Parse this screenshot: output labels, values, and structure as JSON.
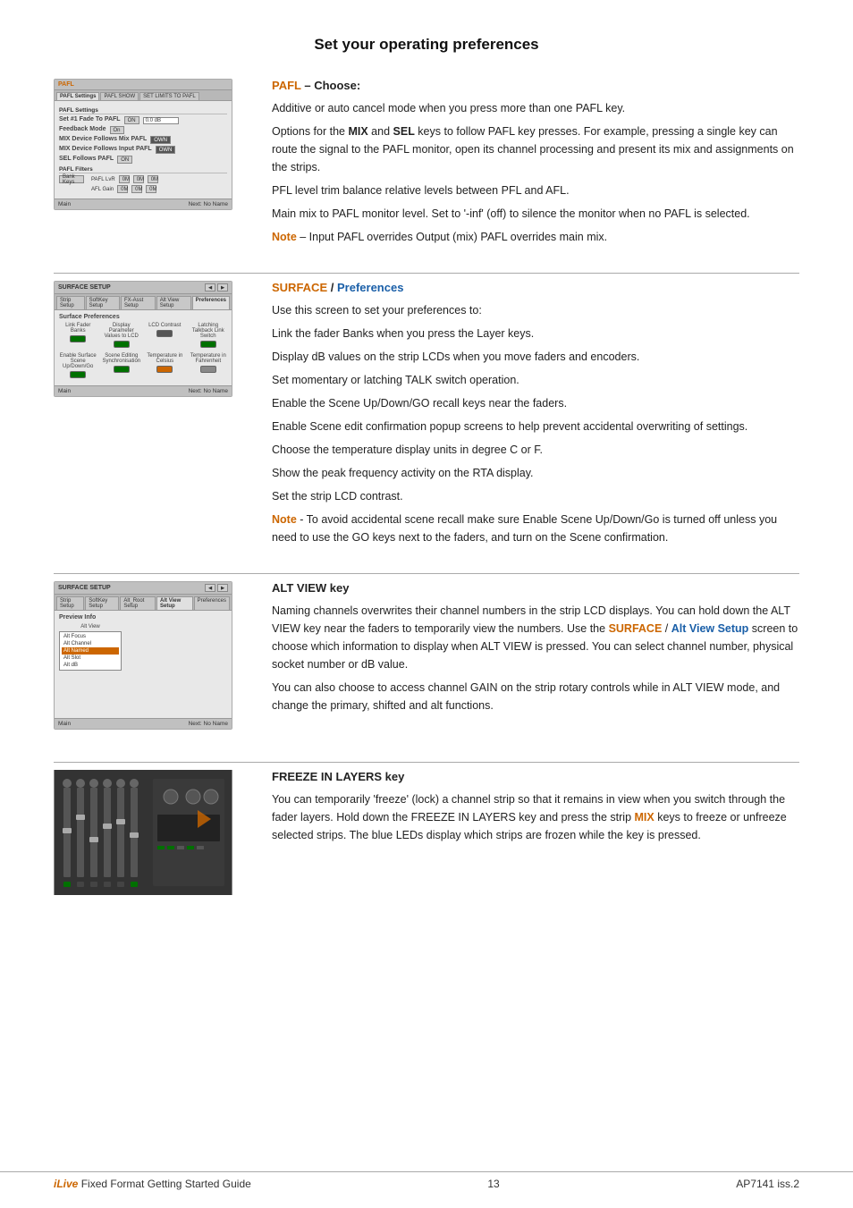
{
  "page": {
    "title": "Set your operating preferences",
    "footer": {
      "left_italic": "iLive",
      "left_rest": " Fixed Format   Getting Started Guide",
      "center": "13",
      "right": "AP7141 iss.2"
    }
  },
  "sections": [
    {
      "id": "pafl",
      "heading_orange": "PAFL",
      "heading_rest": " – Choose:",
      "paragraphs": [
        "Additive or auto cancel mode when you press more than one PAFL key.",
        "Options for the MIX and SEL keys to follow PAFL key presses.  For example, pressing a single key can route the signal to the PAFL monitor, open its channel processing and present its mix and assignments on the strips.",
        "PFL level trim balance relative levels between PFL and AFL.",
        "Main mix to PAFL monitor level.  Set to '-inf' (off) to silence the monitor when no PAFL is selected."
      ],
      "note": "Note – Input PAFL overrides Output (mix) PAFL overrides main mix."
    },
    {
      "id": "surface",
      "heading_orange": "SURFACE",
      "heading_rest": " / ",
      "heading_blue": "Preferences",
      "paragraphs": [
        "Use this screen to set your preferences to:",
        "Link the fader Banks when you press the Layer keys.",
        "Display dB values on the strip LCDs when you move faders and encoders.",
        "Set momentary or latching TALK switch operation.",
        "Enable the Scene Up/Down/GO recall keys near the faders.",
        "Enable Scene edit confirmation popup screens to help prevent accidental overwriting of settings.",
        "Choose the temperature display units in degree C or F.",
        "Show the peak frequency activity on the RTA display.",
        "Set the strip LCD contrast."
      ],
      "note": "Note - To avoid accidental scene recall make sure Enable Scene Up/Down/Go is turned off unless you need to use the GO keys next to the faders, and turn on the Scene confirmation."
    },
    {
      "id": "altview",
      "heading_plain": "ALT VIEW",
      "heading_rest": " key",
      "paragraphs": [
        "Naming channels overwrites their channel numbers in the strip LCD displays. You can hold down the ALT VIEW key near the faders to temporarily view the numbers. Use the SURFACE / Alt View Setup screen to choose which information to display when ALT VIEW is pressed. You can select channel number, physical socket number or dB value.",
        "You can also choose to access channel GAIN on the strip rotary controls while in ALT VIEW mode, and change the primary, shifted and alt functions."
      ],
      "surface_label": "SURFACE",
      "alt_view_label": "Alt View Setup"
    },
    {
      "id": "freeze",
      "heading_plain": "FREEZE IN LAYERS",
      "heading_rest": " key",
      "paragraphs": [
        "You can temporarily 'freeze' (lock) a channel strip so that it remains in view when you switch through the fader layers. Hold down the FREEZE IN LAYERS key and press the strip MIX keys to freeze or unfreeze selected strips. The blue LEDs display which strips are frozen while the key is pressed."
      ],
      "mix_label": "MIX"
    }
  ],
  "screenshots": {
    "pafl": {
      "title": "PAFL",
      "tabs": [
        "PAFL Settings",
        "PAFL SHOW",
        "SET LIMITS TO PAFL"
      ],
      "active_tab": "PAFL Settings",
      "bottom_main": "Main",
      "bottom_next": "Next: No Name"
    },
    "surface_pref": {
      "title": "SURFACE SETUP",
      "tabs": [
        "Strip Setup",
        "SoftKey Setup",
        "FX-Asst Setup",
        "Alt View Setup",
        "Preferences"
      ],
      "active_tab": "Preferences",
      "section_label": "Surface Preferences",
      "grid_items": [
        {
          "label": "Link Fader Banks",
          "state": "on"
        },
        {
          "label": "Display Parameter Values to LCD",
          "state": "on"
        },
        {
          "label": "LCD Contrast",
          "state": "slider"
        },
        {
          "label": "Latching Talkback Link Switch",
          "state": "on"
        }
      ],
      "grid_items2": [
        {
          "label": "Enable Surface Scene Up/Down/Go",
          "state": "on"
        },
        {
          "label": "Scene Editing Synchronisation",
          "state": "on"
        },
        {
          "label": "Temperature in Celsius",
          "state": "on"
        },
        {
          "label": "Temperature in Fahrenheit",
          "state": "off"
        }
      ],
      "bottom_main": "Main",
      "bottom_next": "Next: No Name"
    },
    "alt_view": {
      "title": "SURFACE SETUP",
      "tabs": [
        "Strip Setup",
        "SoftKey Setup",
        "Alt_Root Setup",
        "Alt View Setup",
        "Preferences"
      ],
      "active_tab": "Alt View Setup",
      "section_label": "Preview Info",
      "dropdown_label": "Alt View",
      "dropdown_options": [
        "Alt Focus",
        "Alt Channel",
        "Alt Named",
        "Alt Slot",
        "Alt dB"
      ],
      "active_option": "Alt Named",
      "bottom_main": "Main",
      "bottom_next": "Next: No Name"
    }
  }
}
